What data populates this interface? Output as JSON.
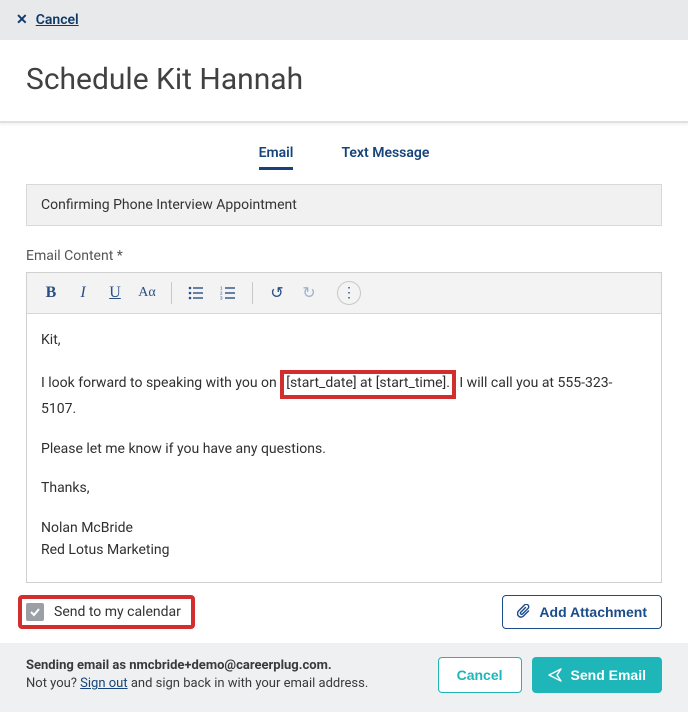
{
  "topbar": {
    "cancel": "Cancel"
  },
  "title": "Schedule Kit Hannah",
  "tabs": {
    "email": "Email",
    "text": "Text Message"
  },
  "subject": "Confirming Phone Interview Appointment",
  "content_label": "Email Content *",
  "body": {
    "greeting": "Kit,",
    "line1_pre": "I look forward to speaking with you on",
    "line1_highlight": "[start_date] at [start_time].",
    "line1_post": "I will call you at 555-323-5107.",
    "line2": "Please let me know if you have any questions.",
    "thanks": "Thanks,",
    "sig_name": "Nolan McBride",
    "sig_company": "Red Lotus Marketing"
  },
  "calendar": {
    "label": "Send to my calendar"
  },
  "attachment": {
    "label": "Add Attachment"
  },
  "footer": {
    "sender_pre": "Sending email as ",
    "sender_email": "nmcbride+demo@careerplug.com",
    "sender_post": ".",
    "notyou_pre": "Not you? ",
    "signout": "Sign out",
    "notyou_post": " and sign back in with your email address.",
    "cancel": "Cancel",
    "send": "Send Email"
  }
}
